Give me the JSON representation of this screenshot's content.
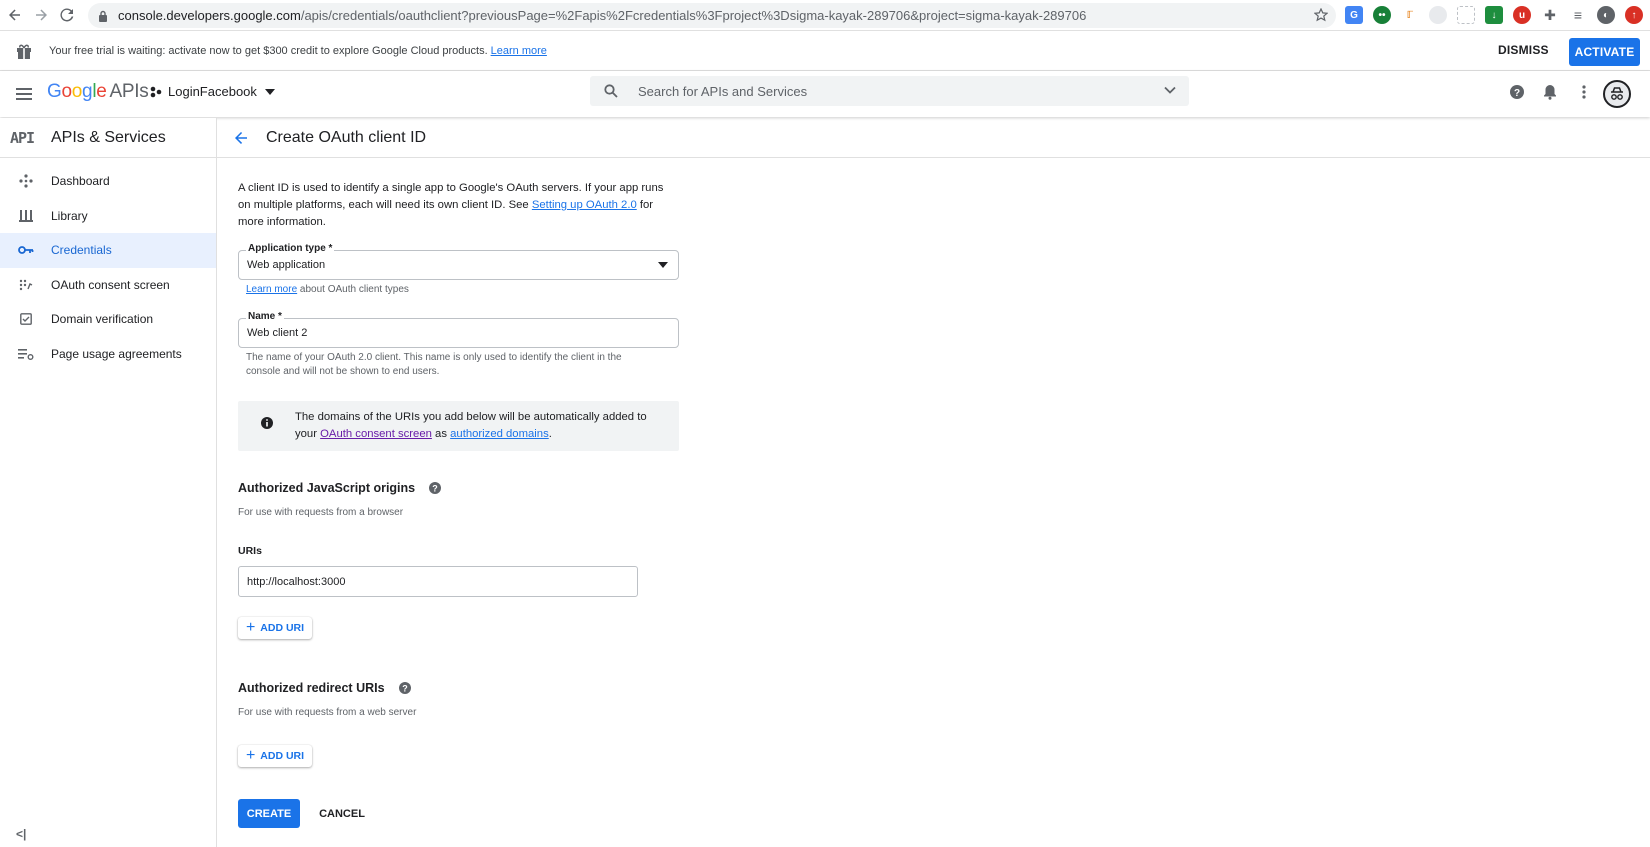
{
  "browser": {
    "url_host": "console.developers.google.com",
    "url_rest": "/apis/credentials/oauthclient?previousPage=%2Fapis%2Fcredentials%3Fproject%3Dsigma-kayak-289706&project=sigma-kayak-289706"
  },
  "banner": {
    "text": "Your free trial is waiting: activate now to get $300 credit to explore Google Cloud products.",
    "link": "Learn more",
    "dismiss": "DISMISS",
    "activate": "ACTIVATE"
  },
  "header": {
    "logo_google": [
      "G",
      "o",
      "o",
      "g",
      "l",
      "e"
    ],
    "logo_apis": "APIs",
    "project": "LoginFacebook",
    "search_placeholder": "Search for APIs and Services"
  },
  "sidebar": {
    "badge": "API",
    "title": "APIs & Services",
    "items": [
      {
        "label": "Dashboard",
        "icon": "dashboard-icon",
        "active": false
      },
      {
        "label": "Library",
        "icon": "library-icon",
        "active": false
      },
      {
        "label": "Credentials",
        "icon": "key-icon",
        "active": true
      },
      {
        "label": "OAuth consent screen",
        "icon": "consent-icon",
        "active": false
      },
      {
        "label": "Domain verification",
        "icon": "checkbox-icon",
        "active": false
      },
      {
        "label": "Page usage agreements",
        "icon": "settings-list-icon",
        "active": false
      }
    ],
    "collapse": "<|"
  },
  "page": {
    "title": "Create OAuth client ID",
    "intro_1": "A client ID is used to identify a single app to Google's OAuth servers. If your app runs on multiple platforms, each will need its own client ID. See",
    "intro_link": "Setting up OAuth 2.0",
    "intro_2": "for more information.",
    "app_type_label": "Application type *",
    "app_type_value": "Web application",
    "app_type_link": "Learn more",
    "app_type_help": "about OAuth client types",
    "name_label": "Name *",
    "name_value": "Web client 2",
    "name_help": "The name of your OAuth 2.0 client. This name is only used to identify the client in the console and will not be shown to end users.",
    "info_1": "The domains of the URIs you add below will be automatically added to your",
    "info_link_1": "OAuth consent screen",
    "info_2": "as",
    "info_link_2": "authorized domains",
    "info_3": ".",
    "js_origins_title": "Authorized JavaScript origins",
    "js_origins_sub": "For use with requests from a browser",
    "uris_label": "URIs",
    "uri_value": "http://localhost:3000",
    "add_uri": "ADD URI",
    "redirect_title": "Authorized redirect URIs",
    "redirect_sub": "For use with requests from a web server",
    "create": "CREATE",
    "cancel": "CANCEL"
  },
  "colors": {
    "accent": "#1a73e8",
    "active_bg": "#e8f0fe",
    "visited_link": "#681da8"
  }
}
